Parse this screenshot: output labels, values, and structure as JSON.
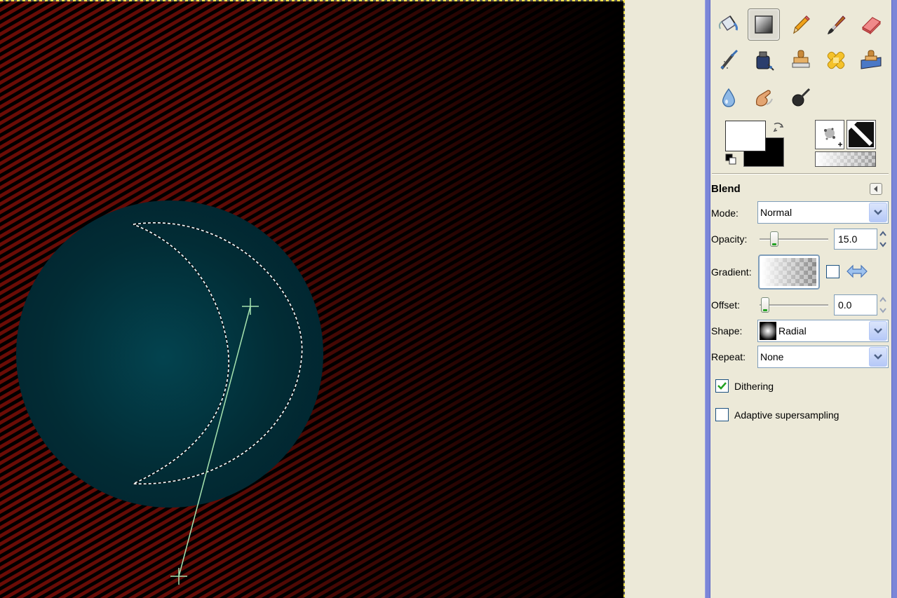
{
  "canvas": {
    "background_color": "#6b0c06",
    "sphere_color": "#03404d",
    "guide_color": "#a6e3b0"
  },
  "toolbox": {
    "tools": [
      {
        "name": "bucket-fill-tool",
        "active": false
      },
      {
        "name": "blend-tool",
        "active": true
      },
      {
        "name": "pencil-tool",
        "active": false
      },
      {
        "name": "paintbrush-tool",
        "active": false
      },
      {
        "name": "eraser-tool",
        "active": false
      },
      {
        "name": "airbrush-tool",
        "active": false
      },
      {
        "name": "ink-tool",
        "active": false
      },
      {
        "name": "clone-tool",
        "active": false
      },
      {
        "name": "heal-tool",
        "active": false
      },
      {
        "name": "perspective-clone-tool",
        "active": false
      },
      {
        "name": "blur-sharpen-tool",
        "active": false
      },
      {
        "name": "smudge-tool",
        "active": false
      },
      {
        "name": "dodge-burn-tool",
        "active": false
      }
    ],
    "foreground_color": "#ffffff",
    "background_color": "#000000"
  },
  "blend": {
    "title": "Blend",
    "mode_label": "Mode:",
    "mode_value": "Normal",
    "opacity_label": "Opacity:",
    "opacity_value": "15.0",
    "opacity_fraction": 0.15,
    "gradient_label": "Gradient:",
    "offset_label": "Offset:",
    "offset_value": "0.0",
    "shape_label": "Shape:",
    "shape_value": "Radial",
    "repeat_label": "Repeat:",
    "repeat_value": "None",
    "dithering_label": "Dithering",
    "dithering_checked": true,
    "adaptive_label": "Adaptive supersampling",
    "adaptive_checked": false
  }
}
